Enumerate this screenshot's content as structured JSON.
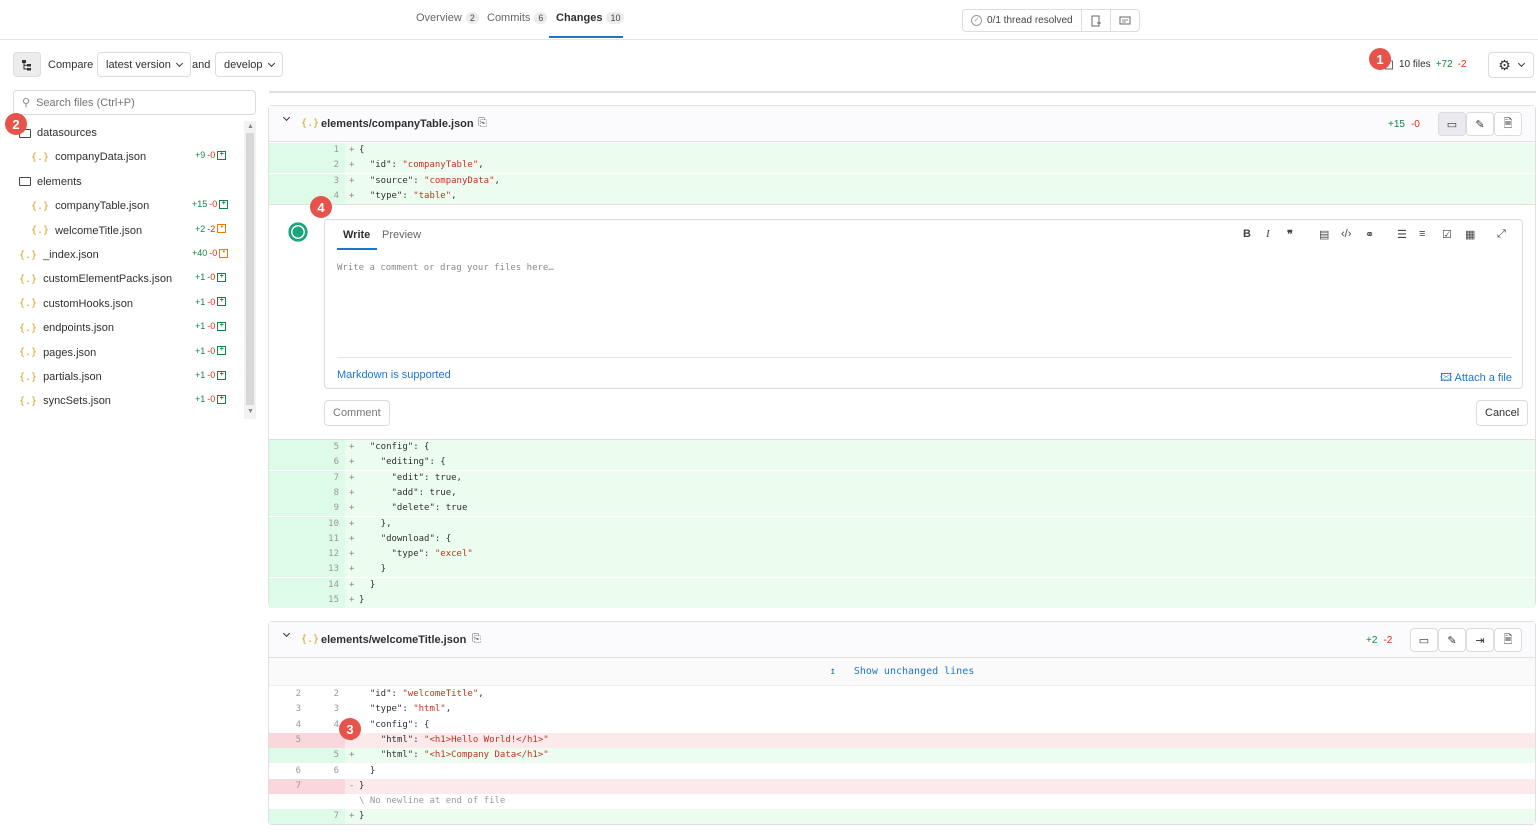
{
  "tabs": [
    {
      "label": "Overview",
      "count": "2"
    },
    {
      "label": "Commits",
      "count": "6"
    },
    {
      "label": "Changes",
      "count": "10"
    }
  ],
  "threads": {
    "label": "0/1 thread resolved"
  },
  "compare": {
    "label": "Compare",
    "source": "latest version",
    "and": "and",
    "target": "develop"
  },
  "stats": {
    "files": "10 files",
    "additions": "+72",
    "deletions": "-2"
  },
  "badges": [
    "1",
    "2",
    "3",
    "4"
  ],
  "search": {
    "placeholder": "Search files (Ctrl+P)"
  },
  "sidebar": {
    "items": [
      {
        "kind": "folder",
        "label": "datasources"
      },
      {
        "kind": "file",
        "label": "companyData.json",
        "add": "+9",
        "del": "-0",
        "status": "added"
      },
      {
        "kind": "folder",
        "label": "elements"
      },
      {
        "kind": "file",
        "label": "companyTable.json",
        "add": "+15",
        "del": "-0",
        "status": "added"
      },
      {
        "kind": "file",
        "label": "welcomeTitle.json",
        "add": "+2",
        "del": "-2",
        "status": "modified"
      },
      {
        "kind": "file",
        "label": "_index.json",
        "add": "+40",
        "del": "-0",
        "status": "modified"
      },
      {
        "kind": "file",
        "label": "customElementPacks.json",
        "add": "+1",
        "del": "-0",
        "status": "added"
      },
      {
        "kind": "file",
        "label": "customHooks.json",
        "add": "+1",
        "del": "-0",
        "status": "added"
      },
      {
        "kind": "file",
        "label": "endpoints.json",
        "add": "+1",
        "del": "-0",
        "status": "added"
      },
      {
        "kind": "file",
        "label": "pages.json",
        "add": "+1",
        "del": "-0",
        "status": "added"
      },
      {
        "kind": "file",
        "label": "partials.json",
        "add": "+1",
        "del": "-0",
        "status": "added"
      },
      {
        "kind": "file",
        "label": "syncSets.json",
        "add": "+1",
        "del": "-0",
        "status": "added"
      }
    ]
  },
  "file1": {
    "path": "elements/companyTable.json",
    "add": "+15",
    "del": "-0",
    "lines_top": [
      {
        "n": "1",
        "t": "{"
      },
      {
        "n": "2",
        "t": "  \"id\": \"companyTable\","
      },
      {
        "n": "3",
        "t": "  \"source\": \"companyData\","
      },
      {
        "n": "4",
        "t": "  \"type\": \"table\","
      }
    ],
    "lines_bottom": [
      {
        "n": "5",
        "t": "  \"config\": {"
      },
      {
        "n": "6",
        "t": "    \"editing\": {"
      },
      {
        "n": "7",
        "t": "      \"edit\": true,"
      },
      {
        "n": "8",
        "t": "      \"add\": true,"
      },
      {
        "n": "9",
        "t": "      \"delete\": true"
      },
      {
        "n": "10",
        "t": "    },"
      },
      {
        "n": "11",
        "t": "    \"download\": {"
      },
      {
        "n": "12",
        "t": "      \"type\": \"excel\""
      },
      {
        "n": "13",
        "t": "    }"
      },
      {
        "n": "14",
        "t": "  }"
      },
      {
        "n": "15",
        "t": "}"
      }
    ]
  },
  "comment_form": {
    "tab_write": "Write",
    "tab_preview": "Preview",
    "placeholder": "Write a comment or drag your files here…",
    "markdown": "Markdown is supported",
    "attach": "Attach a file",
    "comment_btn": "Comment",
    "cancel_btn": "Cancel"
  },
  "file2": {
    "path": "elements/welcomeTitle.json",
    "add": "+2",
    "del": "-2",
    "show_unchanged": "Show unchanged lines",
    "lines": [
      {
        "o": "2",
        "n": "2",
        "sign": "",
        "t": "  \"id\": \"welcomeTitle\","
      },
      {
        "o": "3",
        "n": "3",
        "sign": "",
        "t": "  \"type\": \"html\","
      },
      {
        "o": "4",
        "n": "4",
        "sign": "",
        "t": "  \"config\": {"
      },
      {
        "o": "5",
        "n": "",
        "sign": "-",
        "t": "    \"html\": \"<h1>Hello World!</h1>\""
      },
      {
        "o": "",
        "n": "5",
        "sign": "+",
        "t": "    \"html\": \"<h1>Company Data</h1>\""
      },
      {
        "o": "6",
        "n": "6",
        "sign": "",
        "t": "  }"
      },
      {
        "o": "7",
        "n": "",
        "sign": "-",
        "t": "}"
      },
      {
        "o": "",
        "n": "",
        "sign": "",
        "t": "\\ No newline at end of file"
      },
      {
        "o": "",
        "n": "7",
        "sign": "+",
        "t": "}"
      }
    ]
  }
}
